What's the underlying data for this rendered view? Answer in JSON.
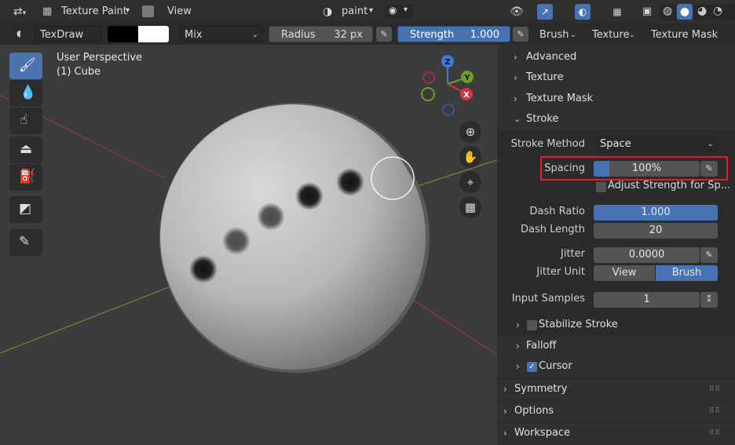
{
  "header": {
    "mode_label": "Texture Paint",
    "view_menu": "View",
    "slot_label": "paint"
  },
  "toolbar": {
    "brush_name": "TexDraw",
    "blend_mode": "Mix",
    "radius_label": "Radius",
    "radius_value": "32 px",
    "strength_label": "Strength",
    "strength_value": "1.000",
    "brush_menu": "Brush",
    "texture_menu": "Texture",
    "texture_mask_menu": "Texture Mask"
  },
  "viewport": {
    "perspective_label": "User Perspective",
    "object_label": "(1) Cube",
    "gizmo": {
      "z": "Z",
      "y": "Y",
      "x": "X"
    }
  },
  "panel": {
    "sections_top": [
      "Advanced",
      "Texture",
      "Texture Mask"
    ],
    "stroke": {
      "title": "Stroke",
      "stroke_method_label": "Stroke Method",
      "stroke_method_value": "Space",
      "spacing_label": "Spacing",
      "spacing_value": "100%",
      "spacing_fraction": 0.15,
      "adjust_strength_label": "Adjust Strength for Sp...",
      "dash_ratio_label": "Dash Ratio",
      "dash_ratio_value": "1.000",
      "dash_length_label": "Dash Length",
      "dash_length_value": "20",
      "jitter_label": "Jitter",
      "jitter_value": "0.0000",
      "jitter_unit_label": "Jitter Unit",
      "jitter_unit_view": "View",
      "jitter_unit_brush": "Brush",
      "input_samples_label": "Input Samples",
      "input_samples_value": "1",
      "stabilize_label": "Stabilize Stroke"
    },
    "falloff_label": "Falloff",
    "cursor_label": "Cursor",
    "sections_bottom": [
      "Symmetry",
      "Options",
      "Workspace"
    ]
  },
  "colors": {
    "accent_blue": "#4772b3",
    "highlight_red": "#e0202a"
  }
}
